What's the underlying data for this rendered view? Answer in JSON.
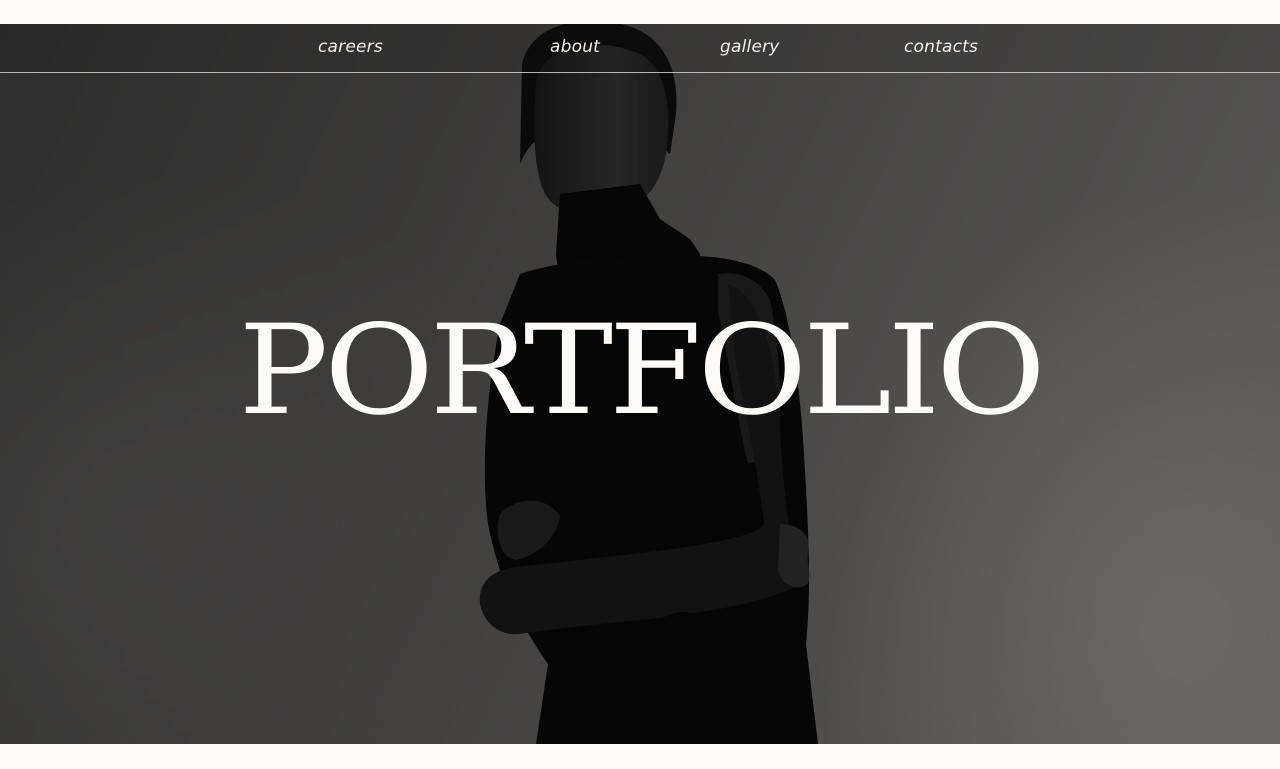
{
  "nav": {
    "items": [
      {
        "label": "careers"
      },
      {
        "label": "about"
      },
      {
        "label": "gallery"
      },
      {
        "label": "contacts"
      }
    ]
  },
  "hero": {
    "title": "PORTFOLIO"
  },
  "colors": {
    "page_background": "#fdfaf7",
    "text": "#f3f0ec",
    "hero_dark": "#2e2e2e",
    "hero_light": "#5c5b5a",
    "figure": "#0b0b0b"
  }
}
